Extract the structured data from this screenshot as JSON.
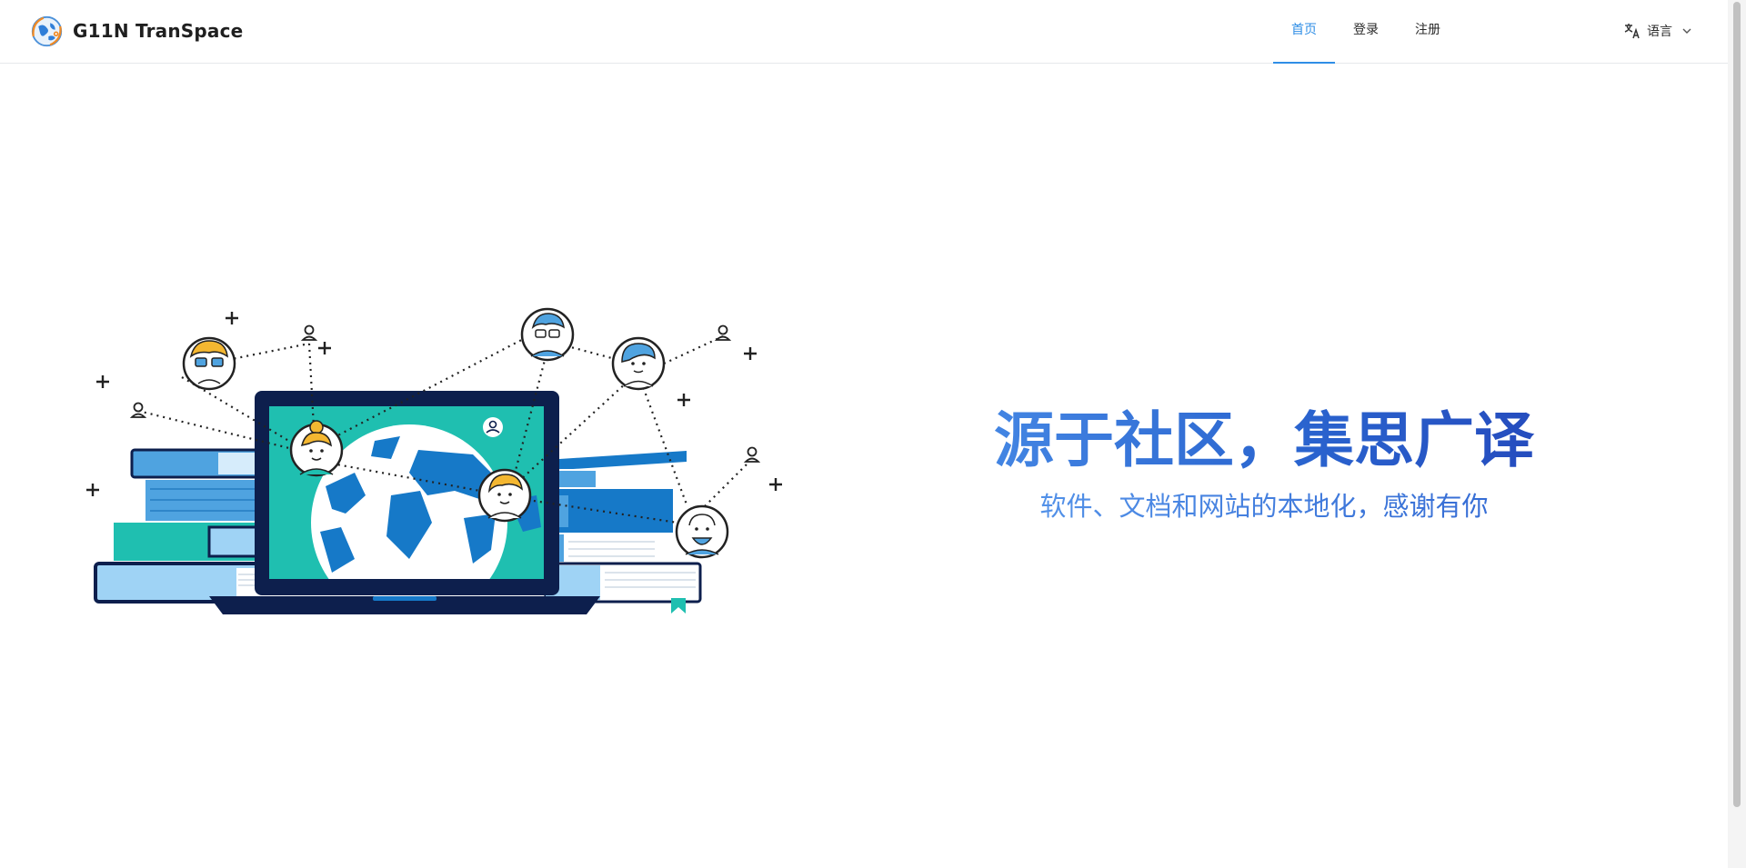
{
  "brand": {
    "name": "G11N TranSpace",
    "logo_icon": "globe-logo-icon"
  },
  "nav": {
    "items": [
      {
        "label": "首页",
        "active": true
      },
      {
        "label": "登录",
        "active": false
      },
      {
        "label": "注册",
        "active": false
      }
    ]
  },
  "language": {
    "label": "语言",
    "icon": "translate-icon"
  },
  "hero": {
    "title": "源于社区，集思广译",
    "subtitle": "软件、文档和网站的本地化，感谢有你"
  },
  "colors": {
    "accent": "#2f8ee6",
    "title_gradient": [
      "#4a8ee8",
      "#2344b8"
    ],
    "laptop_dark": "#0d1f4d",
    "screen_teal": "#1fbfb0",
    "book_blue": "#1679c8",
    "light_blue": "#9fd3f5"
  }
}
